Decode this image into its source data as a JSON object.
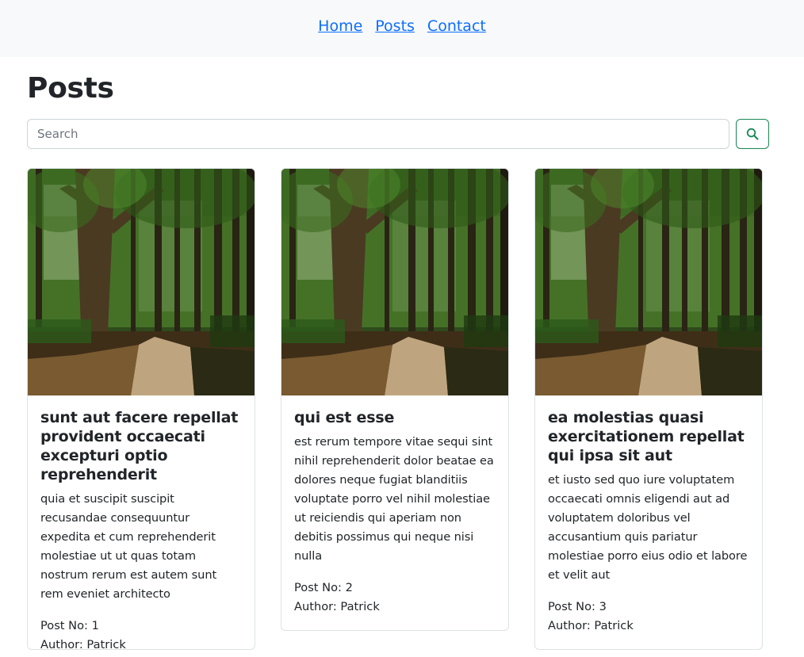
{
  "nav": {
    "links": [
      "Home",
      "Posts",
      "Contact"
    ]
  },
  "page": {
    "title": "Posts"
  },
  "search": {
    "placeholder": "Search",
    "button_icon": "search-icon",
    "button_color": "#198754"
  },
  "posts": [
    {
      "title": "sunt aut facere repellat provident occaecati excepturi optio reprehenderit",
      "body": "quia et suscipit suscipit recusandae consequuntur expedita et cum reprehenderit molestiae ut ut quas totam nostrum rerum est autem sunt rem eveniet architecto",
      "post_no": "Post No: 1",
      "author": "Author: Patrick"
    },
    {
      "title": "qui est esse",
      "body": "est rerum tempore vitae sequi sint nihil reprehenderit dolor beatae ea dolores neque fugiat blanditiis voluptate porro vel nihil molestiae ut reiciendis qui aperiam non debitis possimus qui neque nisi nulla",
      "post_no": "Post No: 2",
      "author": "Author: Patrick"
    },
    {
      "title": "ea molestias quasi exercitationem repellat qui ipsa sit aut",
      "body": "et iusto sed quo iure voluptatem occaecati omnis eligendi aut ad voluptatem doloribus vel accusantium quis pariatur molestiae porro eius odio et labore et velit aut",
      "post_no": "Post No: 3",
      "author": "Author: Patrick"
    }
  ]
}
